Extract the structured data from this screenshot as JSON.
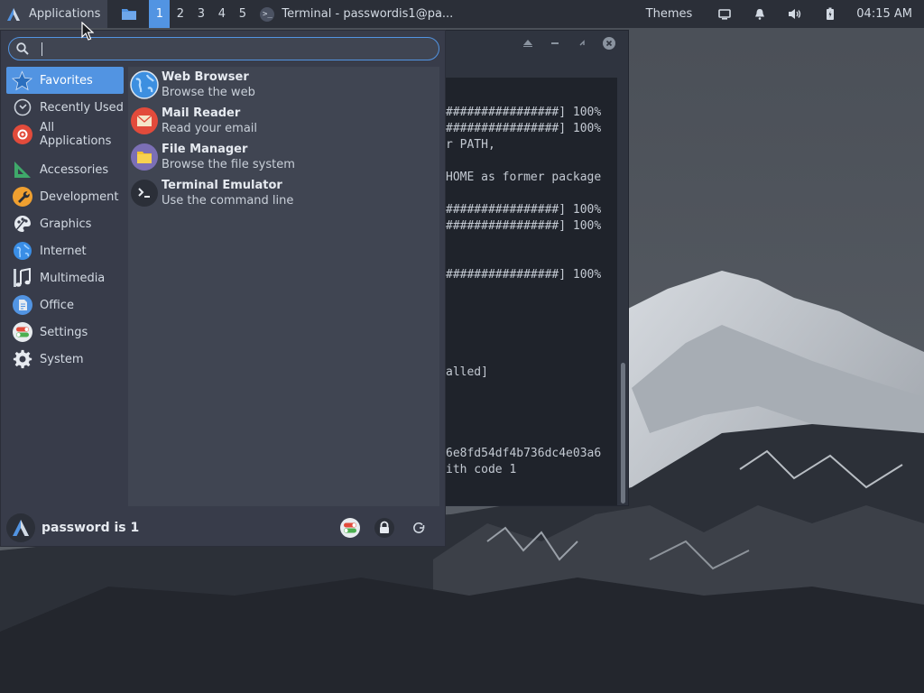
{
  "panel": {
    "applications_label": "Applications",
    "workspaces": [
      "1",
      "2",
      "3",
      "4",
      "5"
    ],
    "active_workspace": "1",
    "task_title": "Terminal - passwordis1@pa...",
    "themes_label": "Themes",
    "clock": "04:15 AM",
    "accent_color": "#5294e2"
  },
  "terminal": {
    "lines": [
      "################] 100%",
      "################] 100%",
      "r PATH,",
      "",
      "HOME as former package",
      "",
      "################] 100%",
      "################] 100%",
      "",
      "",
      "################] 100%",
      "",
      "",
      "",
      "",
      "",
      "alled]",
      "",
      "",
      "",
      "",
      "6e8fd54df4b736dc4e03a6",
      "ith code 1"
    ]
  },
  "menu": {
    "search": {
      "value": "",
      "placeholder": ""
    },
    "categories": [
      {
        "label": "Favorites",
        "icon": "star-icon",
        "active": true
      },
      {
        "label": "Recently Used",
        "icon": "clock-icon",
        "active": false
      },
      {
        "label": "All Applications",
        "icon": "gear-red-icon",
        "active": false
      },
      {
        "label": "Accessories",
        "icon": "ruler-icon",
        "active": false
      },
      {
        "label": "Development",
        "icon": "wrench-icon",
        "active": false
      },
      {
        "label": "Graphics",
        "icon": "palette-icon",
        "active": false
      },
      {
        "label": "Internet",
        "icon": "globe-icon",
        "active": false
      },
      {
        "label": "Multimedia",
        "icon": "music-note-icon",
        "active": false
      },
      {
        "label": "Office",
        "icon": "document-icon",
        "active": false
      },
      {
        "label": "Settings",
        "icon": "toggle-icon",
        "active": false
      },
      {
        "label": "System",
        "icon": "cog-icon",
        "active": false
      }
    ],
    "apps": [
      {
        "name": "Web Browser",
        "desc": "Browse the web",
        "icon": "web-browser-icon"
      },
      {
        "name": "Mail Reader",
        "desc": "Read your email",
        "icon": "mail-icon"
      },
      {
        "name": "File Manager",
        "desc": "Browse the file system",
        "icon": "folder-icon"
      },
      {
        "name": "Terminal Emulator",
        "desc": "Use the command line",
        "icon": "terminal-icon"
      }
    ],
    "user_name": "password is 1"
  }
}
